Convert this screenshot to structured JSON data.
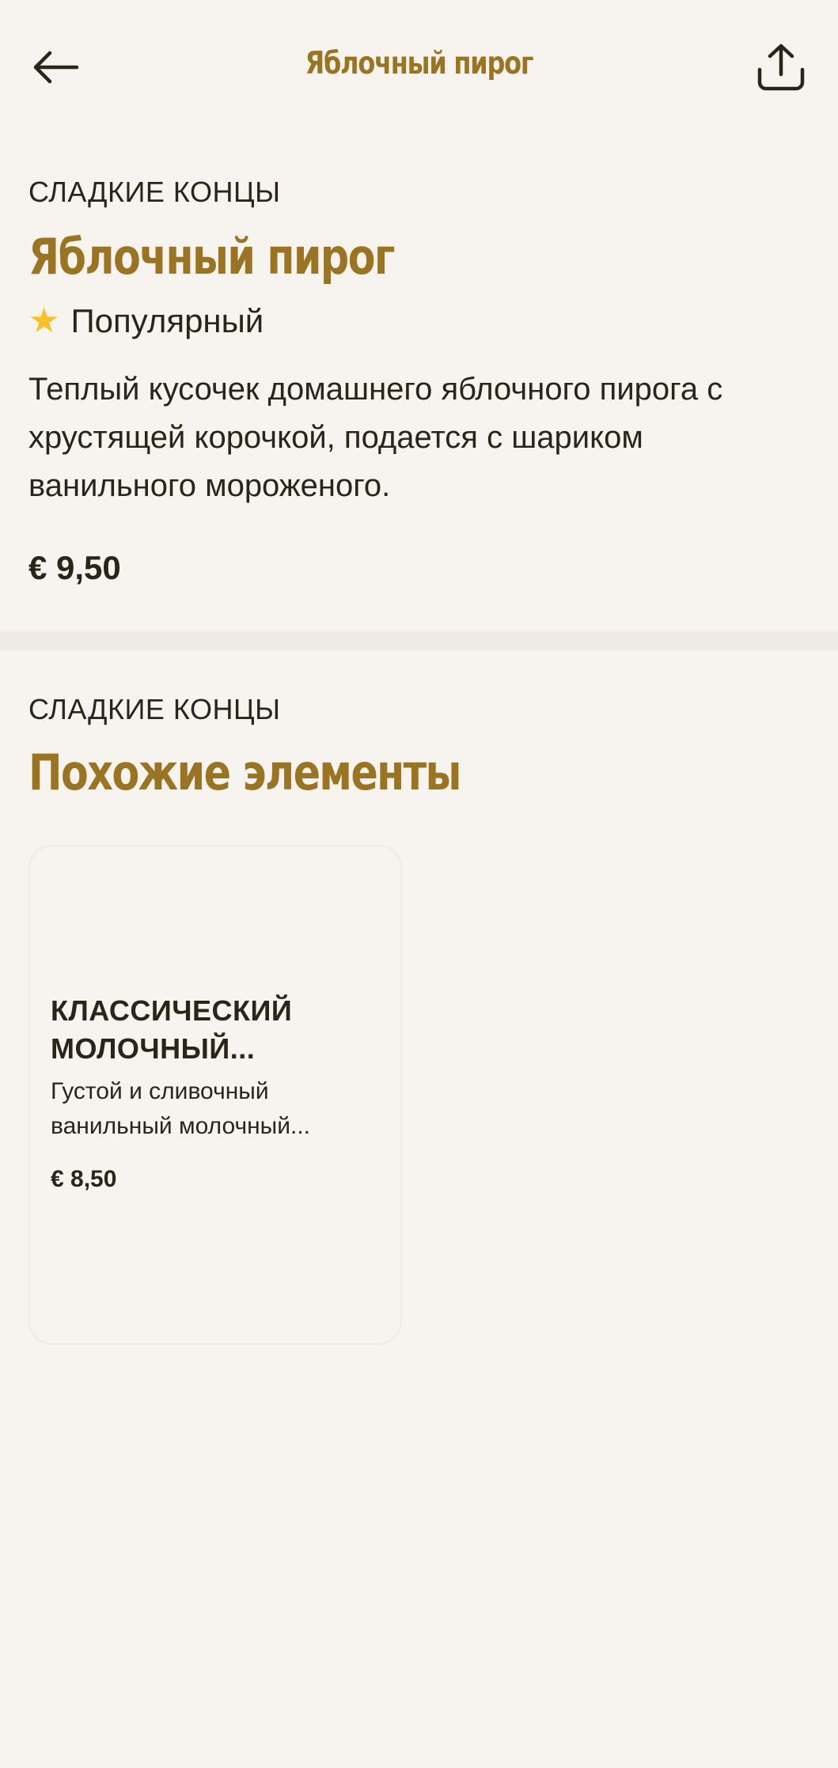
{
  "header": {
    "title": "Яблочный пирог",
    "back_icon": "arrow-left-icon",
    "share_icon": "share-upload-icon"
  },
  "item": {
    "category": "СЛАДКИЕ КОНЦЫ",
    "title": "Яблочный пирог",
    "badge_icon": "star-icon",
    "badge_label": "Популярный",
    "description": "Теплый кусочек домашнего яблочного пирога с хрустящей корочкой, подается с шариком ванильного мороженого.",
    "price": "€ 9,50"
  },
  "related": {
    "category": "СЛАДКИЕ КОНЦЫ",
    "title": "Похожие элементы",
    "cards": [
      {
        "title": "КЛАССИЧЕСКИЙ МОЛОЧНЫЙ...",
        "description": "Густой и сливочный ванильный молочный...",
        "price": "€ 8,50"
      }
    ]
  },
  "colors": {
    "background": "#f7f4ef",
    "accent": "#9a7422",
    "text": "#2b2519",
    "star": "#f5c02a"
  }
}
